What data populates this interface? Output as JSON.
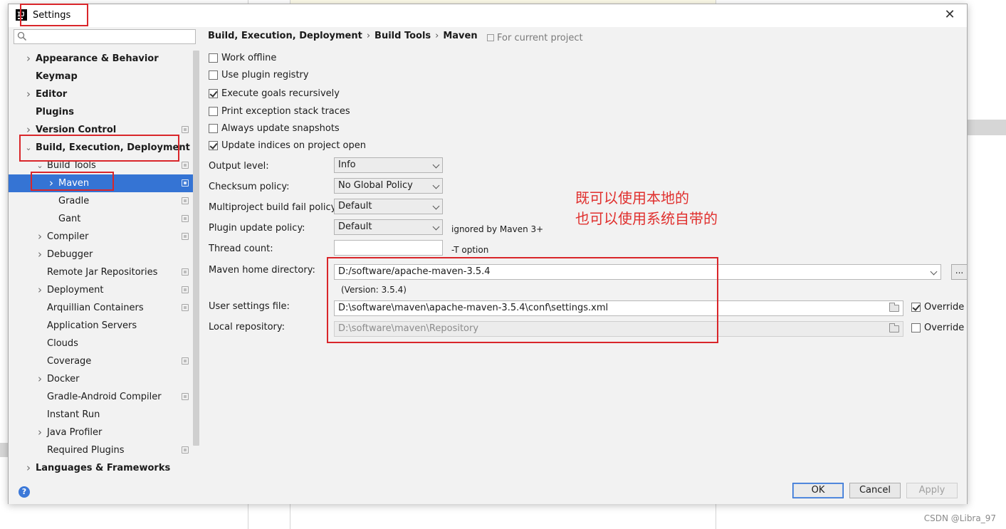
{
  "window": {
    "title": "Settings"
  },
  "search": {
    "placeholder": ""
  },
  "tree": [
    {
      "label": "Appearance & Behavior",
      "bold": true,
      "arrow": "right",
      "indent": 0,
      "proj": false
    },
    {
      "label": "Keymap",
      "bold": true,
      "arrow": "",
      "indent": 0,
      "proj": false
    },
    {
      "label": "Editor",
      "bold": true,
      "arrow": "right",
      "indent": 0,
      "proj": false
    },
    {
      "label": "Plugins",
      "bold": true,
      "arrow": "",
      "indent": 0,
      "proj": false
    },
    {
      "label": "Version Control",
      "bold": true,
      "arrow": "right",
      "indent": 0,
      "proj": true
    },
    {
      "label": "Build, Execution, Deployment",
      "bold": true,
      "arrow": "down",
      "indent": 0,
      "proj": false
    },
    {
      "label": "Build Tools",
      "bold": false,
      "arrow": "down",
      "indent": 1,
      "proj": true
    },
    {
      "label": "Maven",
      "bold": false,
      "arrow": "right",
      "indent": 2,
      "proj": true,
      "selected": true
    },
    {
      "label": "Gradle",
      "bold": false,
      "arrow": "",
      "indent": 2,
      "proj": true
    },
    {
      "label": "Gant",
      "bold": false,
      "arrow": "",
      "indent": 2,
      "proj": true
    },
    {
      "label": "Compiler",
      "bold": false,
      "arrow": "right",
      "indent": 1,
      "proj": true
    },
    {
      "label": "Debugger",
      "bold": false,
      "arrow": "right",
      "indent": 1,
      "proj": false
    },
    {
      "label": "Remote Jar Repositories",
      "bold": false,
      "arrow": "",
      "indent": 1,
      "proj": true
    },
    {
      "label": "Deployment",
      "bold": false,
      "arrow": "right",
      "indent": 1,
      "proj": true
    },
    {
      "label": "Arquillian Containers",
      "bold": false,
      "arrow": "",
      "indent": 1,
      "proj": true
    },
    {
      "label": "Application Servers",
      "bold": false,
      "arrow": "",
      "indent": 1,
      "proj": false
    },
    {
      "label": "Clouds",
      "bold": false,
      "arrow": "",
      "indent": 1,
      "proj": false
    },
    {
      "label": "Coverage",
      "bold": false,
      "arrow": "",
      "indent": 1,
      "proj": true
    },
    {
      "label": "Docker",
      "bold": false,
      "arrow": "right",
      "indent": 1,
      "proj": false
    },
    {
      "label": "Gradle-Android Compiler",
      "bold": false,
      "arrow": "",
      "indent": 1,
      "proj": true
    },
    {
      "label": "Instant Run",
      "bold": false,
      "arrow": "",
      "indent": 1,
      "proj": false
    },
    {
      "label": "Java Profiler",
      "bold": false,
      "arrow": "right",
      "indent": 1,
      "proj": false
    },
    {
      "label": "Required Plugins",
      "bold": false,
      "arrow": "",
      "indent": 1,
      "proj": true
    },
    {
      "label": "Languages & Frameworks",
      "bold": true,
      "arrow": "right",
      "indent": 0,
      "proj": false
    }
  ],
  "breadcrumb": {
    "part1": "Build, Execution, Deployment",
    "part2": "Build Tools",
    "part3": "Maven",
    "separator": "›",
    "scope": "For current project"
  },
  "checkboxes": [
    {
      "label": "Work offline",
      "checked": false
    },
    {
      "label": "Use plugin registry",
      "checked": false
    },
    {
      "label": "Execute goals recursively",
      "checked": true
    },
    {
      "label": "Print exception stack traces",
      "checked": false
    },
    {
      "label": "Always update snapshots",
      "checked": false
    },
    {
      "label": "Update indices on project open",
      "checked": true
    }
  ],
  "form": {
    "output_level_label": "Output level:",
    "output_level_value": "Info",
    "checksum_label": "Checksum policy:",
    "checksum_value": "No Global Policy",
    "multiproject_label": "Multiproject build fail policy:",
    "multiproject_value": "Default",
    "plugin_update_label": "Plugin update policy:",
    "plugin_update_value": "Default",
    "plugin_update_hint": "ignored by Maven 3+",
    "thread_count_label": "Thread count:",
    "thread_count_value": "",
    "thread_count_hint": "-T option",
    "maven_home_label": "Maven home directory:",
    "maven_home_value": "D:/software/apache-maven-3.5.4",
    "browse_label": "...",
    "version_text": "(Version: 3.5.4)",
    "user_settings_label": "User settings file:",
    "user_settings_value": "D:\\software\\maven\\apache-maven-3.5.4\\conf\\settings.xml",
    "user_settings_override_label": "Override",
    "user_settings_override_checked": true,
    "local_repo_label": "Local repository:",
    "local_repo_value": "D:\\software\\maven\\Repository",
    "local_repo_override_label": "Override",
    "local_repo_override_checked": false
  },
  "annotation": {
    "line1": "既可以使用本地的",
    "line2": "也可以使用系统自带的",
    "color": "#e0302e"
  },
  "footer": {
    "help_label": "?",
    "ok_label": "OK",
    "cancel_label": "Cancel",
    "apply_label": "Apply"
  },
  "watermark": "CSDN @Libra_97",
  "colors": {
    "selection": "#3574d4",
    "highlight_box": "#d9262a"
  }
}
